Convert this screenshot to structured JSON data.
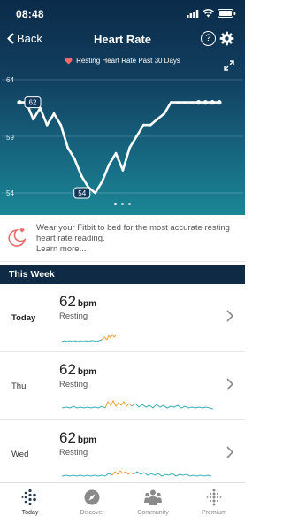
{
  "status_bar": {
    "time": "08:48"
  },
  "nav": {
    "back_label": "Back",
    "title": "Heart Rate",
    "help_label": "?"
  },
  "chart_header": {
    "title": "Resting Heart Rate Past 30 Days"
  },
  "chart_data": {
    "type": "line",
    "title": "Resting Heart Rate Past 30 Days",
    "yticks": [
      "64",
      "59",
      "54"
    ],
    "ylim": [
      53,
      65
    ],
    "x": [
      1,
      2,
      3,
      4,
      5,
      6,
      7,
      8,
      9,
      10,
      11,
      12,
      13,
      14,
      15,
      16,
      17,
      18,
      19,
      20,
      21,
      22,
      23,
      24,
      25,
      26,
      27,
      28,
      29,
      30
    ],
    "values": [
      62,
      62,
      60.5,
      61.5,
      60,
      61,
      60,
      58,
      57,
      55.5,
      54.5,
      54,
      55,
      56.5,
      57.5,
      56,
      58,
      59,
      60,
      60,
      60.5,
      61,
      62,
      62,
      62,
      62,
      62,
      62,
      62,
      62
    ],
    "callouts": [
      {
        "label": "62"
      },
      {
        "label": "54"
      }
    ],
    "grid": true
  },
  "tip": {
    "text": "Wear your Fitbit to bed for the most accurate resting heart rate reading.",
    "link": "Learn more..."
  },
  "section": {
    "title": "This Week"
  },
  "rows": [
    {
      "day": "Today",
      "bpm": "62",
      "unit": "bpm",
      "label": "Resting"
    },
    {
      "day": "Thu",
      "bpm": "62",
      "unit": "bpm",
      "label": "Resting"
    },
    {
      "day": "Wed",
      "bpm": "62",
      "unit": "bpm",
      "label": "Resting"
    }
  ],
  "tabs": [
    {
      "label": "Today"
    },
    {
      "label": "Discover"
    },
    {
      "label": "Community"
    },
    {
      "label": "Premium"
    }
  ],
  "colors": {
    "header_top": "#0b2b4a",
    "header_bottom": "#1b8795",
    "section_bg": "#0e2a45",
    "spark_teal": "#3ab0b7",
    "spark_orange": "#f0a030"
  }
}
